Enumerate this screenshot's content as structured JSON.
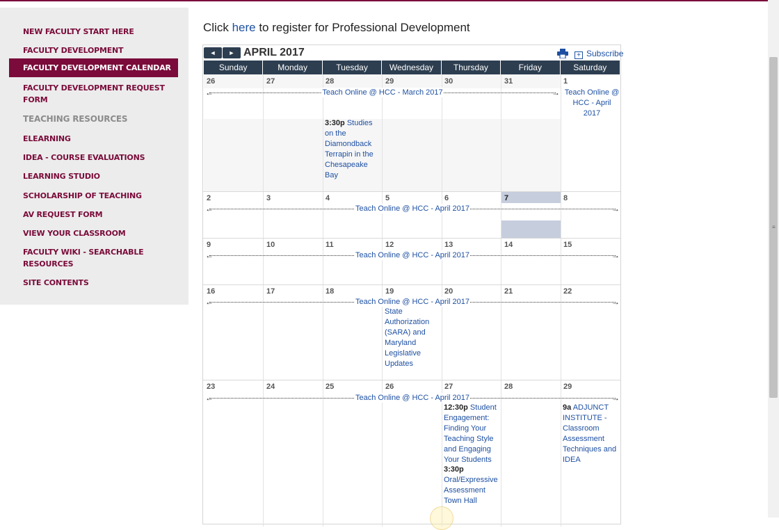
{
  "sidebar": {
    "items": [
      {
        "label": "NEW FACULTY START HERE"
      },
      {
        "label": "FACULTY DEVELOPMENT"
      },
      {
        "label": "FACULTY DEVELOPMENT CALENDAR"
      },
      {
        "label": "FACULTY DEVELOPMENT REQUEST FORM"
      },
      {
        "label": "TEACHING RESOURCES"
      },
      {
        "label": "ELEARNING"
      },
      {
        "label": "IDEA - COURSE EVALUATIONS"
      },
      {
        "label": "LEARNING STUDIO"
      },
      {
        "label": "SCHOLARSHIP OF TEACHING"
      },
      {
        "label": "AV REQUEST FORM"
      },
      {
        "label": "VIEW YOUR CLASSROOM"
      },
      {
        "label": "FACULTY WIKI - SEARCHABLE RESOURCES"
      },
      {
        "label": "SITE CONTENTS"
      }
    ]
  },
  "register": {
    "prefix": "Click ",
    "link": "here",
    "suffix": " to register for Professional Development"
  },
  "calendar": {
    "month": "APRIL 2017",
    "prev_icon": "◄",
    "next_icon": "►",
    "subscribe_label": "Subscribe",
    "icons": {
      "print": "print-icon",
      "subscribe": "subscribe-icon",
      "prev": "prev-month-icon",
      "next": "next-month-icon"
    },
    "day_names": [
      "Sunday",
      "Monday",
      "Tuesday",
      "Wednesday",
      "Thursday",
      "Friday",
      "Saturday"
    ],
    "weeks": [
      {
        "dates": [
          "26",
          "27",
          "28",
          "29",
          "30",
          "31",
          "1"
        ]
      },
      {
        "dates": [
          "2",
          "3",
          "4",
          "5",
          "6",
          "7",
          "8"
        ]
      },
      {
        "dates": [
          "9",
          "10",
          "11",
          "12",
          "13",
          "14",
          "15"
        ]
      },
      {
        "dates": [
          "16",
          "17",
          "18",
          "19",
          "20",
          "21",
          "22"
        ]
      },
      {
        "dates": [
          "23",
          "24",
          "25",
          "26",
          "27",
          "28",
          "29"
        ]
      }
    ],
    "span_events": [
      {
        "label": "Teach Online @ HCC - March 2017"
      },
      {
        "label": "Teach Online @ HCC - April 2017"
      },
      {
        "label": "Teach Online @ HCC - April 2017"
      },
      {
        "label": "Teach Online @ HCC - April 2017"
      },
      {
        "label": "Teach Online @ HCC - April 2017"
      }
    ],
    "week1_sat_event": "Teach Online @ HCC - April 2017",
    "events": [
      {
        "time": "3:30p",
        "title": "Studies on the Diamondback Terrapin in the Chesapeake Bay"
      },
      {
        "time": "",
        "title": "State Authorization (SARA) and Maryland Legislative Updates"
      },
      {
        "time": "12:30p",
        "title": "Student Engagement: Finding Your Teaching Style and Engaging Your Students"
      },
      {
        "time": "3:30p",
        "title": "Oral/Expressive Assessment Town Hall"
      },
      {
        "time": "9a",
        "title": "ADJUNCT INSTITUTE -Classroom Assessment Techniques and IDEA"
      }
    ],
    "today": "7",
    "colors": {
      "header_bg": "#2d3e50",
      "today_bg": "#c6cddd",
      "link": "#1e50a2",
      "accent": "#7a0b3a"
    }
  }
}
